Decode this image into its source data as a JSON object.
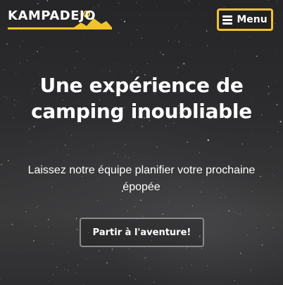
{
  "brand": {
    "logo_text": "KAMPADEJO",
    "accent_color": "#f3c32a"
  },
  "navbar": {
    "menu_label": "Menu",
    "menu_icon": "hamburger-icon"
  },
  "hero": {
    "headline": "Une expérience de camping inoubliable",
    "subtitle": "Laissez notre équipe planifier votre prochaine épopée",
    "cta_label": "Partir à l'aventure!",
    "background": "night-sky-stars"
  }
}
